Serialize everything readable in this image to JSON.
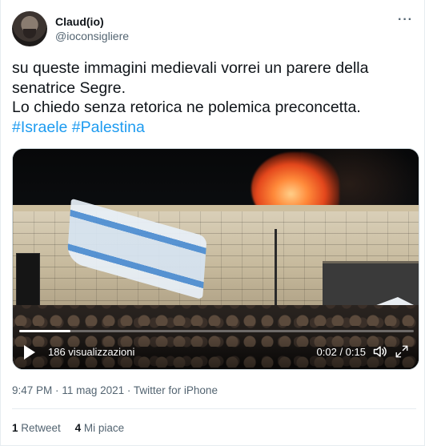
{
  "author": {
    "display_name": "Claud(io)",
    "handle": "@ioconsigliere"
  },
  "more_menu_label": "···",
  "tweet": {
    "line1": "su queste immagini medievali vorrei un parere della",
    "line2": "senatrice Segre.",
    "line3": "Lo chiedo senza retorica ne polemica preconcetta.",
    "hashtags": [
      "#Israele",
      "#Palestina"
    ]
  },
  "video": {
    "views": "186 visualizzazioni",
    "time": "0:02 / 0:15",
    "progress_fraction": 0.13
  },
  "meta": {
    "time": "9:47 PM",
    "separator": "·",
    "date": "11 mag 2021",
    "source": "Twitter for iPhone"
  },
  "stats": {
    "retweets_count": "1",
    "retweets_label": "Retweet",
    "likes_count": "4",
    "likes_label": "Mi piace"
  },
  "colors": {
    "hashtag": "#1d9bf0",
    "secondary_text": "#536471"
  }
}
